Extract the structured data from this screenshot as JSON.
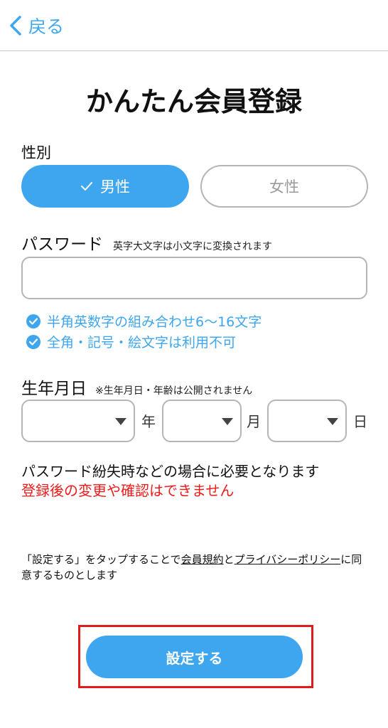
{
  "header": {
    "back_label": "戻る"
  },
  "page": {
    "title": "かんたん会員登録"
  },
  "gender": {
    "label": "性別",
    "options": [
      {
        "label": "男性",
        "selected": true
      },
      {
        "label": "女性",
        "selected": false
      }
    ]
  },
  "password": {
    "label": "パスワード",
    "note": "英字大文字は小文字に変換されます",
    "value": "",
    "rules": [
      "半角英数字の組み合わせ6〜16文字",
      "全角・記号・絵文字は利用不可"
    ]
  },
  "birthdate": {
    "label": "生年月日",
    "note": "※生年月日・年齢は公開されません",
    "year_unit": "年",
    "month_unit": "月",
    "day_unit": "日",
    "year_value": "",
    "month_value": "",
    "day_value": ""
  },
  "info": {
    "line1": "パスワード紛失時などの場合に必要となります",
    "warning": "登録後の変更や確認はできません"
  },
  "terms": {
    "prefix": "「設定する」をタップすることで",
    "terms_link": "会員規約",
    "and": "と",
    "privacy_link": "プライバシーポリシー",
    "suffix": "に同意するものとします"
  },
  "submit": {
    "label": "設定する"
  },
  "colors": {
    "accent": "#3ea6ee",
    "warning": "#ee1b1b",
    "highlight_border": "#e01b1b",
    "border": "#b5b5b5"
  }
}
